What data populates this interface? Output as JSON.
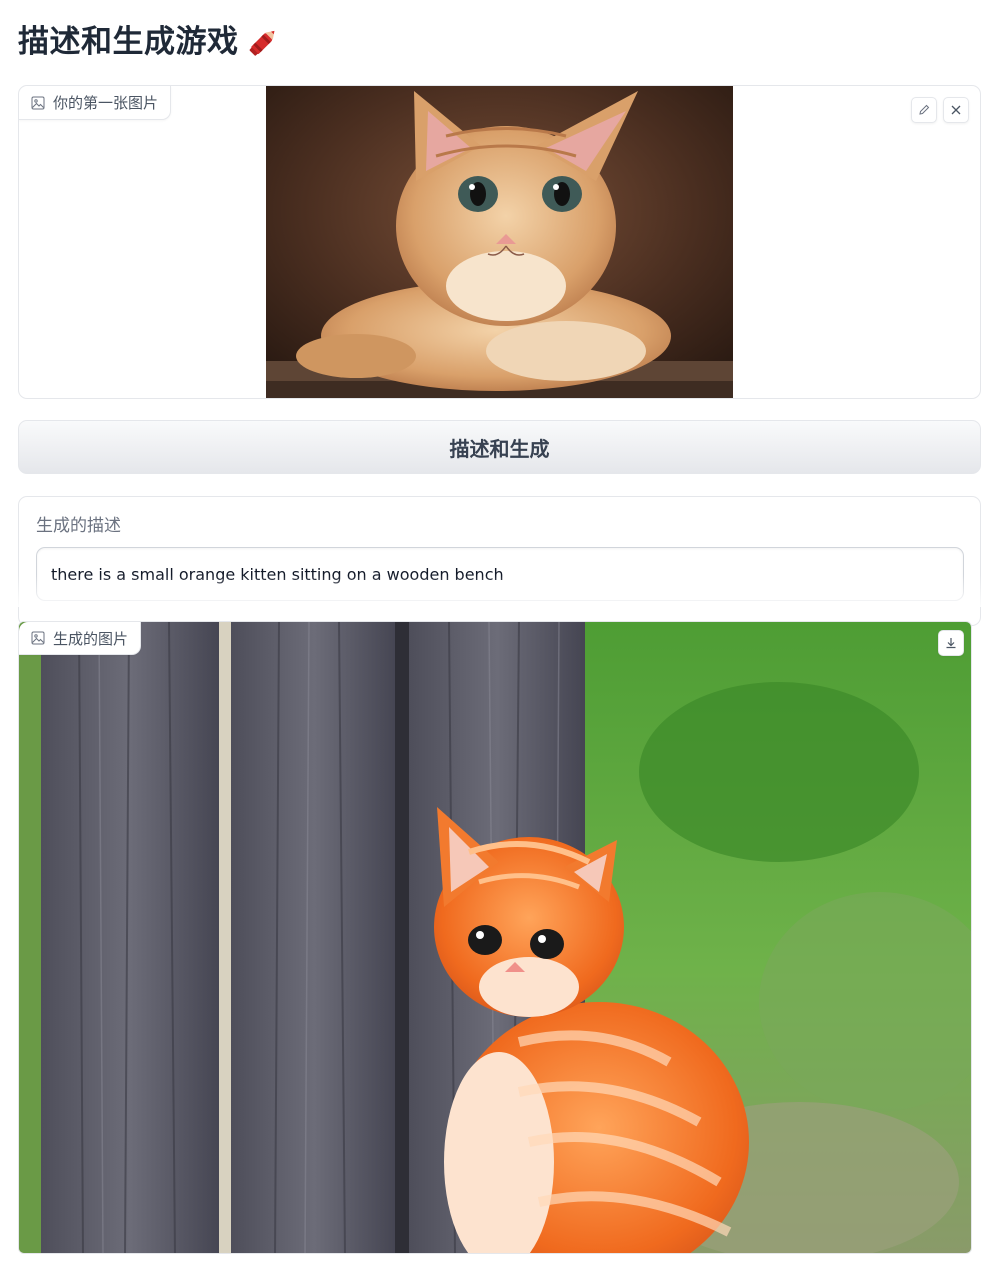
{
  "page": {
    "title": "描述和生成游戏"
  },
  "input_image": {
    "label": "你的第一张图片",
    "actions": [
      "edit-icon",
      "clear-icon"
    ]
  },
  "generate_button": {
    "label": "描述和生成"
  },
  "description": {
    "label": "生成的描述",
    "value": "there is a small orange kitten sitting on a wooden bench"
  },
  "output_image": {
    "label": "生成的图片",
    "actions": [
      "download-icon"
    ]
  },
  "colors": {
    "accent_crayon": "#d62b2b",
    "border": "#e5e7eb",
    "button_bg_top": "#f9fafb",
    "button_bg_bottom": "#e5e7eb"
  }
}
